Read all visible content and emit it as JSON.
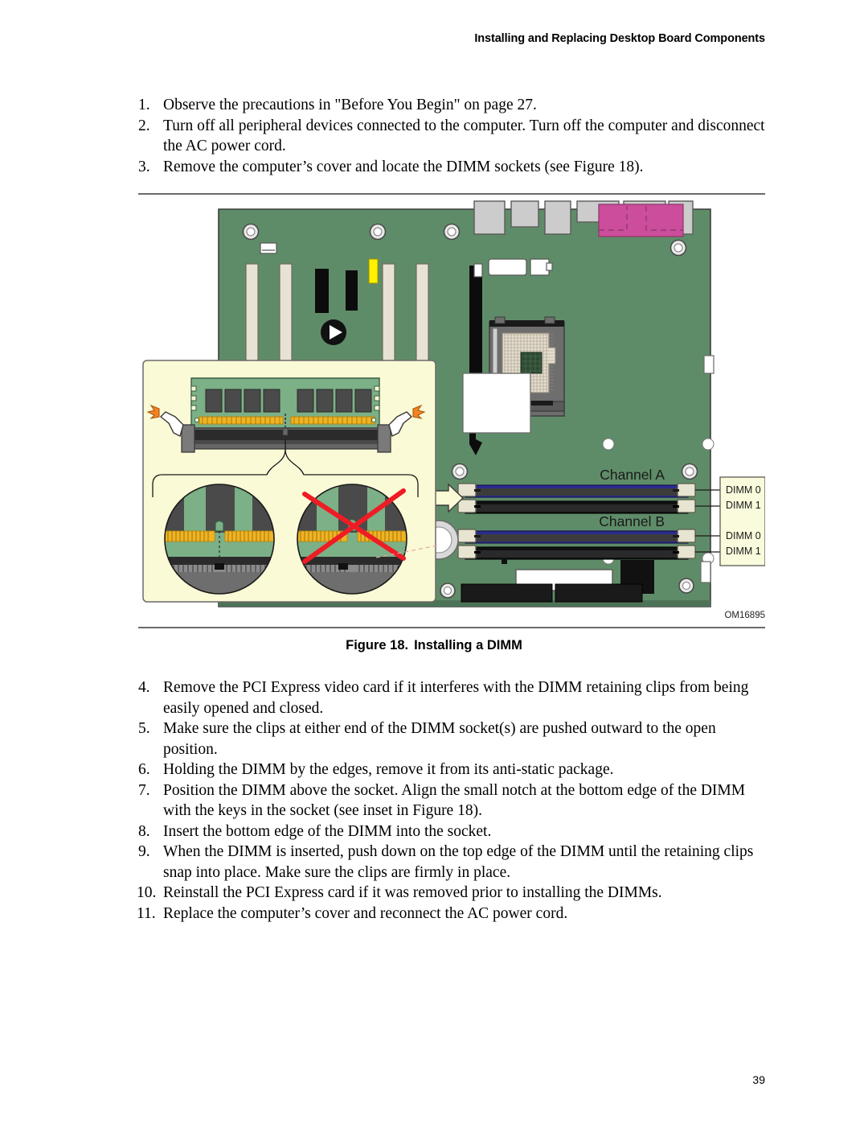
{
  "header": {
    "title": "Installing and Replacing Desktop Board Components"
  },
  "steps_before": [
    {
      "num": "1.",
      "text": "Observe the precautions in \"Before You Begin\" on page 27."
    },
    {
      "num": "2.",
      "text": "Turn off all peripheral devices connected to the computer.  Turn off the computer and disconnect the AC power cord."
    },
    {
      "num": "3.",
      "text": "Remove the computer’s cover and locate the DIMM sockets (see Figure 18)."
    }
  ],
  "figure": {
    "caption_number": "Figure 18.",
    "caption_title": "Installing a DIMM",
    "om_code": "OM16895",
    "channel_a_label": "Channel A",
    "channel_b_label": "Channel B",
    "socket_labels": {
      "channel_a_dimm0": "DIMM 0",
      "channel_a_dimm1": "DIMM 1",
      "channel_b_dimm0": "DIMM 0",
      "channel_b_dimm1": "DIMM 1"
    },
    "colors": {
      "pcb_green": "#5f8c68",
      "pcb_green_dark": "#4d7357",
      "dimm0_socket_blue": "#2b2b8f",
      "dimm1_socket_black": "#111111",
      "slot_beige": "#e8e2d4",
      "callout_cream": "#fbfad6",
      "label_box_cream": "#fafadc",
      "audio_connector_magenta": "#cc4d9b",
      "highlight_yellow": "#fff200",
      "error_red": "#ee1c25",
      "arrow_orange": "#f58220",
      "module_green": "#7cb087",
      "chip_gray": "#4a4a4a",
      "contact_gold": "#f0b323"
    }
  },
  "steps_after": [
    {
      "num": "4.",
      "text": "Remove the PCI Express video card if it interferes with the DIMM retaining clips from being easily opened and closed."
    },
    {
      "num": "5.",
      "text": "Make sure the clips at either end of the DIMM socket(s) are pushed outward to the open position."
    },
    {
      "num": "6.",
      "text": "Holding the DIMM by the edges, remove it from its anti-static package."
    },
    {
      "num": "7.",
      "text": "Position the DIMM above the socket.  Align the small notch at the bottom edge of the DIMM with the keys in the socket (see inset in Figure 18)."
    },
    {
      "num": "8.",
      "text": "Insert the bottom edge of the DIMM into the socket."
    },
    {
      "num": "9.",
      "text": "When the DIMM is inserted, push down on the top edge of the DIMM until the retaining clips snap into place.  Make sure the clips are firmly in place."
    },
    {
      "num": "10.",
      "text": "Reinstall the PCI Express card if it was removed prior to installing the DIMMs."
    },
    {
      "num": "11.",
      "text": "Replace the computer’s cover and reconnect the AC power cord."
    }
  ],
  "footer": {
    "page_number": "39"
  }
}
